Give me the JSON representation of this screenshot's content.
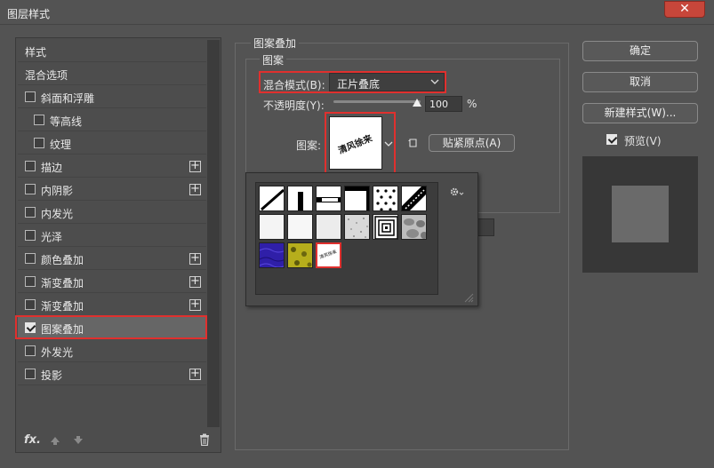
{
  "window": {
    "title": "图层样式",
    "close_label": "✕"
  },
  "style_list": {
    "items": [
      {
        "label": "样式",
        "checkbox": false,
        "plus": false
      },
      {
        "label": "混合选项",
        "checkbox": false,
        "plus": false
      },
      {
        "label": "斜面和浮雕",
        "checkbox": true,
        "checked": false,
        "plus": false
      },
      {
        "label": "等高线",
        "checkbox": true,
        "checked": false,
        "plus": false,
        "indent": true
      },
      {
        "label": "纹理",
        "checkbox": true,
        "checked": false,
        "plus": false,
        "indent": true
      },
      {
        "label": "描边",
        "checkbox": true,
        "checked": false,
        "plus": true
      },
      {
        "label": "内阴影",
        "checkbox": true,
        "checked": false,
        "plus": true
      },
      {
        "label": "内发光",
        "checkbox": true,
        "checked": false,
        "plus": false
      },
      {
        "label": "光泽",
        "checkbox": true,
        "checked": false,
        "plus": false
      },
      {
        "label": "颜色叠加",
        "checkbox": true,
        "checked": false,
        "plus": true
      },
      {
        "label": "渐变叠加",
        "checkbox": true,
        "checked": false,
        "plus": true
      },
      {
        "label": "渐变叠加",
        "checkbox": true,
        "checked": false,
        "plus": true
      },
      {
        "label": "图案叠加",
        "checkbox": true,
        "checked": true,
        "plus": false,
        "selected": true
      },
      {
        "label": "外发光",
        "checkbox": true,
        "checked": false,
        "plus": false
      },
      {
        "label": "投影",
        "checkbox": true,
        "checked": false,
        "plus": true
      }
    ],
    "footer": {
      "fx_label": "fx",
      "fx_sub": "."
    }
  },
  "pattern_overlay": {
    "group_title": "图案叠加",
    "sub_title": "图案",
    "blend_mode_label": "混合模式(B):",
    "blend_mode_value": "正片叠底",
    "opacity_label": "不透明度(Y):",
    "opacity_value": "100",
    "opacity_unit": "%",
    "opacity_level": 1.0,
    "pattern_label": "图案:",
    "pattern_preview_text": "清风徐来",
    "snap_origin_label": "贴紧原点(A)",
    "swatch_last_text": "清风徐来"
  },
  "buttons": {
    "ok": "确定",
    "cancel": "取消",
    "new_style": "新建样式(W)...",
    "preview_label": "预览(V)",
    "preview_checked": true
  },
  "colors": {
    "accent_red": "#e0302e",
    "panel": "#535353",
    "close_red": "#c7463a"
  }
}
